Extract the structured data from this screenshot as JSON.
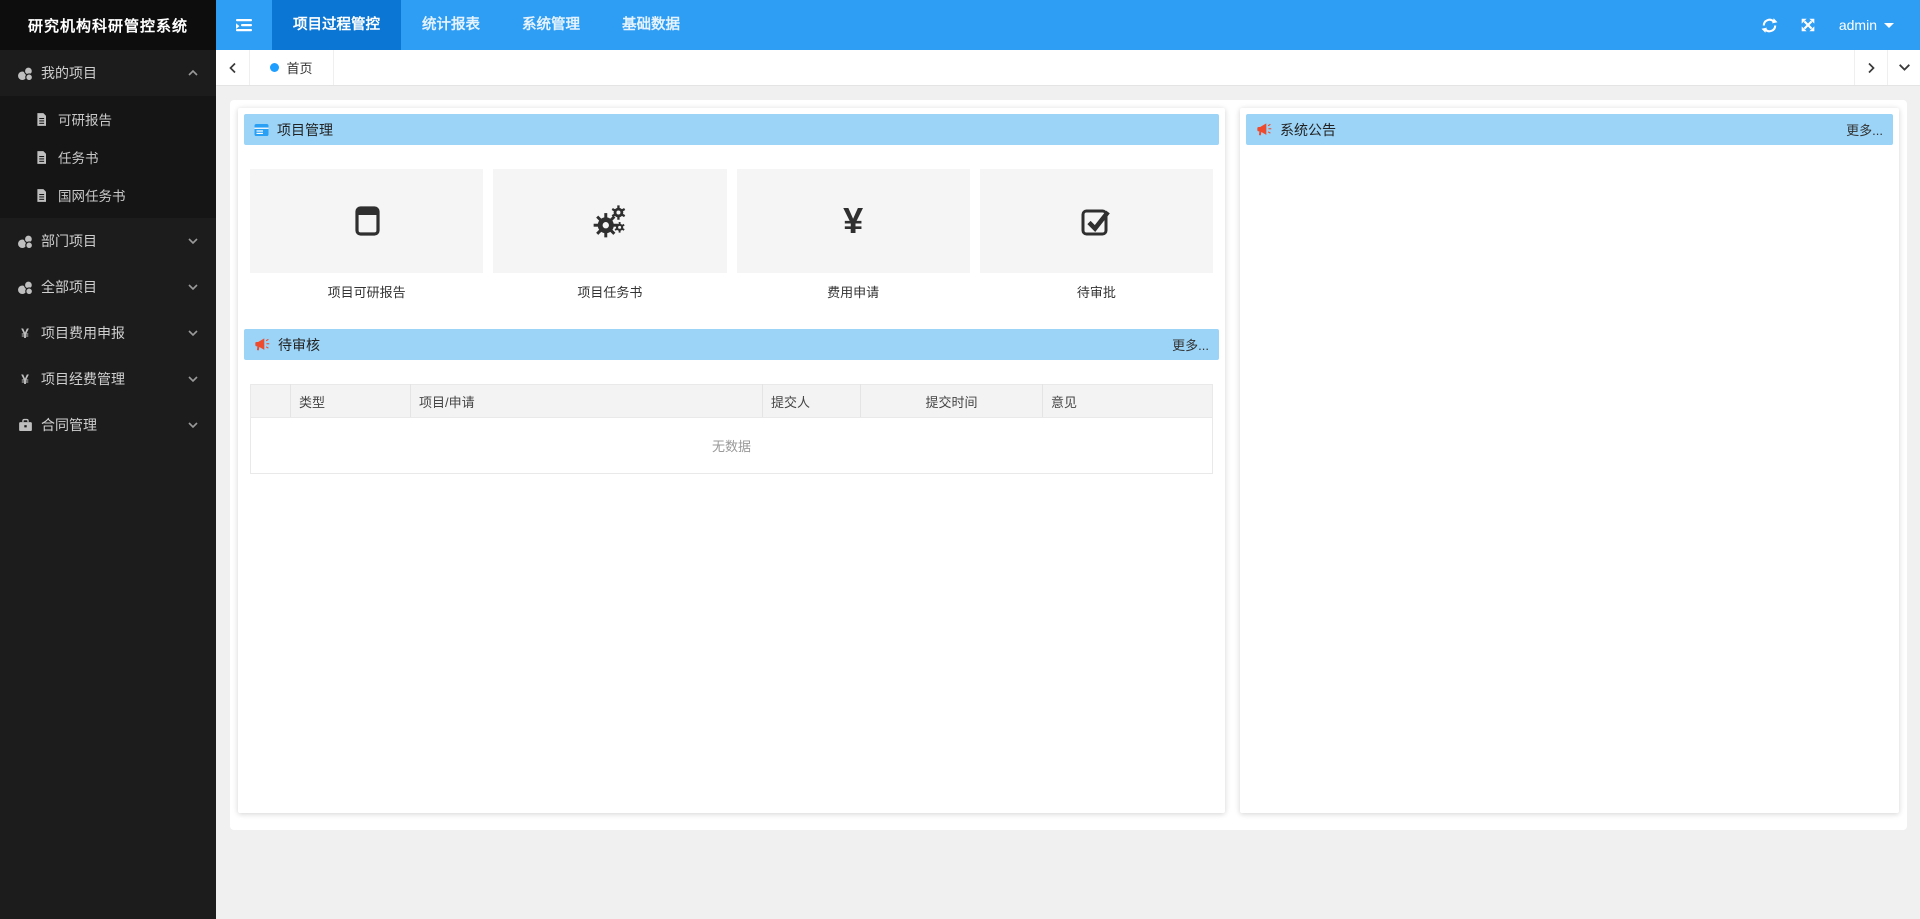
{
  "app": {
    "title": "研究机构科研管控系统"
  },
  "navbar": {
    "menu": [
      {
        "label": "项目过程管控",
        "active": true
      },
      {
        "label": "统计报表",
        "active": false
      },
      {
        "label": "系统管理",
        "active": false
      },
      {
        "label": "基础数据",
        "active": false
      }
    ],
    "user": "admin",
    "icons": {
      "collapse": "hamburger-icon",
      "refresh": "refresh-icon",
      "fullscreen": "fullscreen-icon",
      "user_caret": "caret-down-icon"
    }
  },
  "tabbar": {
    "active_tab": "首页"
  },
  "sidebar": {
    "items": [
      {
        "label": "我的项目",
        "icon": "projects-cluster-icon",
        "expanded": true,
        "children": [
          {
            "label": "可研报告"
          },
          {
            "label": "任务书"
          },
          {
            "label": "国网任务书"
          }
        ]
      },
      {
        "label": "部门项目",
        "icon": "projects-cluster-icon",
        "expanded": false
      },
      {
        "label": "全部项目",
        "icon": "projects-cluster-icon",
        "expanded": false
      },
      {
        "label": "项目费用申报",
        "icon": "yen-icon",
        "yen": "¥",
        "expanded": false
      },
      {
        "label": "项目经费管理",
        "icon": "yen-icon",
        "yen": "¥",
        "expanded": false
      },
      {
        "label": "合同管理",
        "icon": "briefcase-icon",
        "expanded": false
      }
    ]
  },
  "panels": {
    "project_mgmt": {
      "title": "项目管理",
      "icon": "window-list-icon",
      "cards": [
        {
          "label": "项目可研报告",
          "icon": "window-maximize-icon"
        },
        {
          "label": "项目任务书",
          "icon": "cogs-icon"
        },
        {
          "label": "费用申请",
          "icon": "yen-icon",
          "glyph": "¥"
        },
        {
          "label": "待审批",
          "icon": "check-square-icon"
        }
      ]
    },
    "pending_review": {
      "title": "待审核",
      "icon": "megaphone-icon",
      "more": "更多...",
      "table": {
        "headers": [
          "",
          "类型",
          "项目/申请",
          "提交人",
          "提交时间",
          "意见"
        ],
        "empty": "无数据"
      }
    },
    "announcements": {
      "title": "系统公告",
      "icon": "megaphone-icon",
      "more": "更多..."
    }
  },
  "colors": {
    "navbar": "#2e9df4",
    "navbar_active": "#0b76d3",
    "panel_header": "#9cd4f7",
    "accent_blue": "#1e9fff",
    "megaphone_red": "#ee4b2e",
    "sidebar_bg": "#1c1c1c"
  }
}
